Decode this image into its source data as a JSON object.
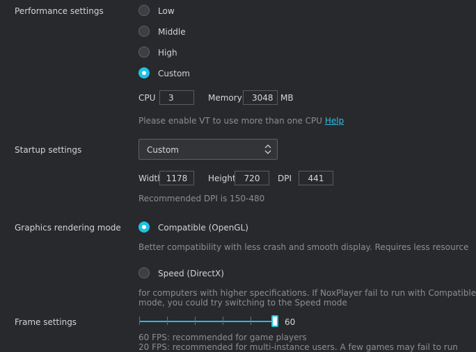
{
  "performance": {
    "label": "Performance settings",
    "options": [
      "Low",
      "Middle",
      "High",
      "Custom"
    ],
    "selected": "Custom",
    "cpu_label": "CPU",
    "cpu_value": "3",
    "memory_label": "Memory",
    "memory_value": "3048",
    "memory_unit": "MB",
    "vt_hint": "Please enable VT to use more than one CPU",
    "help_link": "Help"
  },
  "startup": {
    "label": "Startup settings",
    "selected": "Custom",
    "width_label": "Width",
    "width_value": "1178",
    "height_label": "Height",
    "height_value": "720",
    "dpi_label": "DPI",
    "dpi_value": "441",
    "dpi_hint": "Recommended DPI is 150-480"
  },
  "graphics": {
    "label": "Graphics rendering mode",
    "opengl_label": "Compatible (OpenGL)",
    "opengl_desc": "Better compatibility with less crash and smooth display. Requires less resource",
    "directx_label": "Speed (DirectX)",
    "directx_desc_line1": "for computers with higher specifications. If NoxPlayer fail to run with Compatible",
    "directx_desc_line2": "mode, you could try switching to the Speed mode",
    "selected": "Compatible (OpenGL)"
  },
  "frame": {
    "label": "Frame settings",
    "value": "60",
    "level": 1.0,
    "hint_line1": "60 FPS: recommended for game players",
    "hint_line2": "20 FPS: recommended for multi-instance users. A few games may fail to run"
  },
  "colors": {
    "accent": "#1ec1e4",
    "background": "#27292d",
    "hint_text": "#8c8e92"
  }
}
